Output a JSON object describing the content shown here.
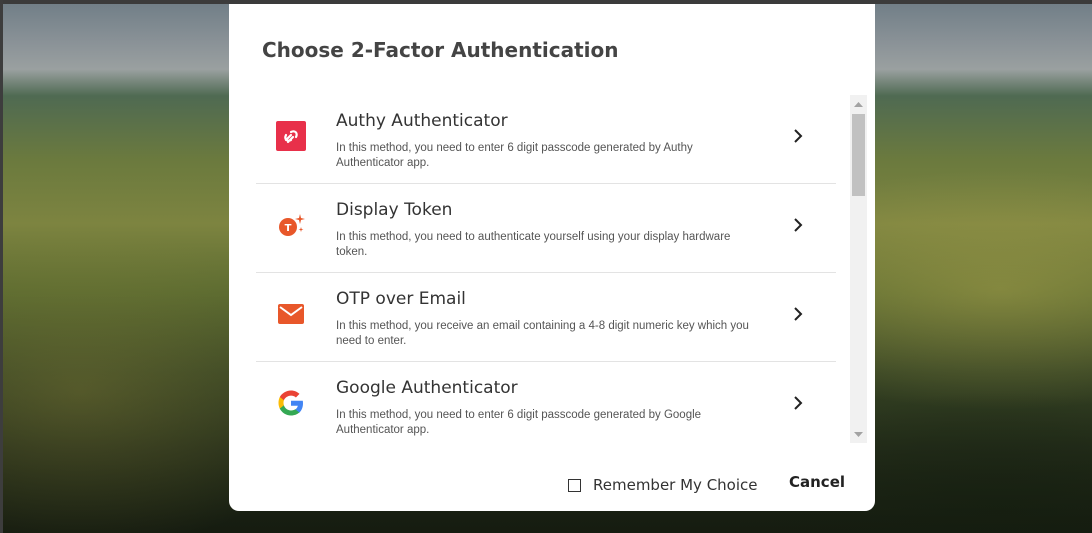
{
  "dialog": {
    "title": "Choose 2-Factor Authentication",
    "methods": [
      {
        "title": "Authy Authenticator",
        "description": "In this method, you need to enter 6 digit passcode generated by Authy Authenticator app.",
        "icon": "authy-icon",
        "color": "#e8304a"
      },
      {
        "title": "Display Token",
        "description": "In this method, you need to authenticate yourself using your display hardware token.",
        "icon": "display-token-icon",
        "color": "#e8572a"
      },
      {
        "title": "OTP over Email",
        "description": "In this method, you receive an email containing a 4-8 digit numeric key which you need to enter.",
        "icon": "email-icon",
        "color": "#e8572a"
      },
      {
        "title": "Google Authenticator",
        "description": "In this method, you need to enter 6 digit passcode generated by Google Authenticator app.",
        "icon": "google-icon",
        "color": "#4285f4"
      }
    ],
    "remember_label": "Remember My Choice",
    "remember_checked": false,
    "cancel_label": "Cancel"
  }
}
